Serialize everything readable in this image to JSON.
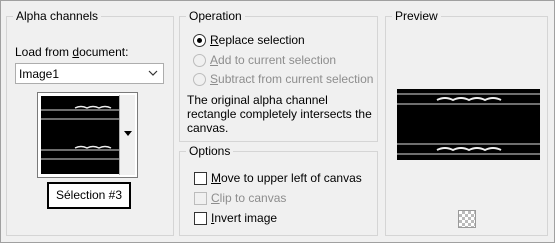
{
  "alpha": {
    "title": "Alpha channels",
    "load_label_prefix": "Load from ",
    "load_label_key": "d",
    "load_label_suffix": "ocument:",
    "document_value": "Image1",
    "selection_name": "Sélection #3"
  },
  "operation": {
    "title": "Operation",
    "options": [
      {
        "key": "R",
        "rest": "eplace selection",
        "selected": true,
        "enabled": true
      },
      {
        "key": "A",
        "rest": "dd to current selection",
        "selected": false,
        "enabled": false
      },
      {
        "key": "S",
        "rest": "ubtract from current selection",
        "selected": false,
        "enabled": false
      }
    ],
    "description": "The original alpha channel rectangle completely intersects the canvas."
  },
  "options": {
    "title": "Options",
    "items": [
      {
        "key": "M",
        "rest": "ove to upper left of canvas",
        "checked": false,
        "enabled": true
      },
      {
        "key": "C",
        "rest": "lip to canvas",
        "checked": false,
        "enabled": false
      },
      {
        "key": "I",
        "rest": "nvert image",
        "checked": false,
        "enabled": true
      }
    ]
  },
  "preview": {
    "title": "Preview",
    "icon": "checkerboard-icon"
  }
}
